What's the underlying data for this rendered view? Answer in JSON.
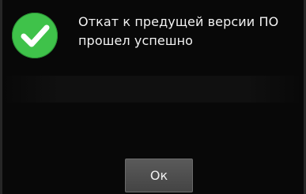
{
  "dialog": {
    "icon": "checkmark-success-icon",
    "message": "Откат к предущей версии ПО прошел успешно",
    "ok_label": "Ок"
  },
  "colors": {
    "background": "#080808",
    "success_green": "#3fc24a",
    "button": "#4f4f4f",
    "text": "#f2f2f2"
  }
}
